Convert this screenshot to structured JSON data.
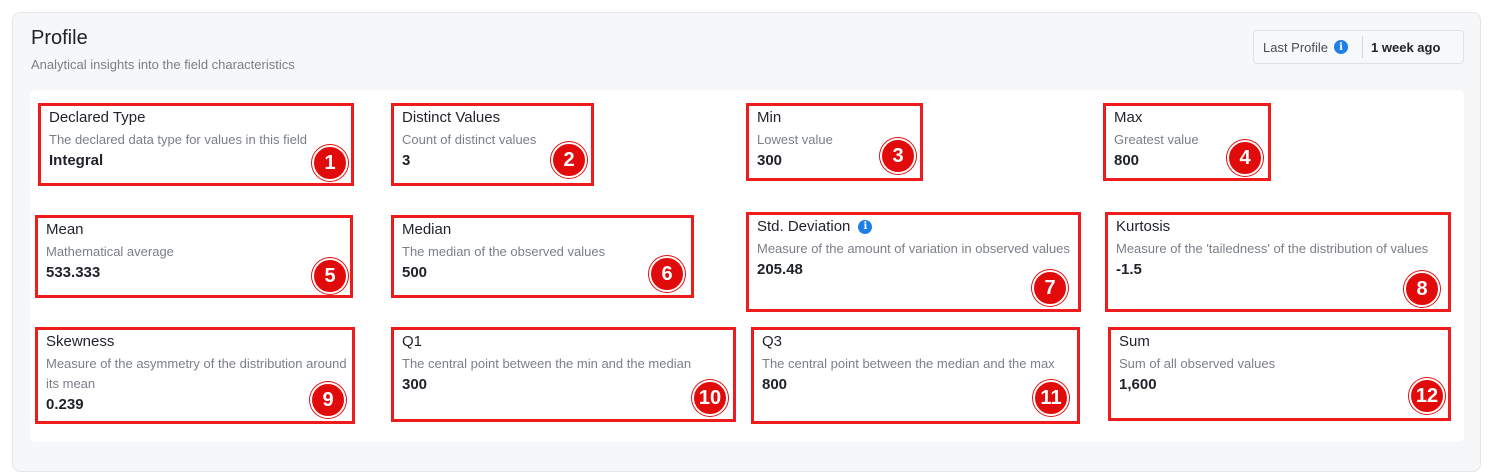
{
  "header": {
    "title": "Profile",
    "subtitle": "Analytical insights into the field characteristics",
    "last_profile_label": "Last Profile",
    "last_profile_info_icon": "info-icon",
    "last_profile_value": "1 week ago"
  },
  "metrics": [
    {
      "title": "Declared Type",
      "desc": "The declared data type for values in this field",
      "value": "Integral",
      "badge": "1"
    },
    {
      "title": "Distinct Values",
      "desc": "Count of distinct values",
      "value": "3",
      "badge": "2"
    },
    {
      "title": "Min",
      "desc": "Lowest value",
      "value": "300",
      "badge": "3"
    },
    {
      "title": "Max",
      "desc": "Greatest value",
      "value": "800",
      "badge": "4"
    },
    {
      "title": "Mean",
      "desc": "Mathematical average",
      "value": "533.333",
      "badge": "5"
    },
    {
      "title": "Median",
      "desc": "The median of the observed values",
      "value": "500",
      "badge": "6"
    },
    {
      "title": "Std. Deviation",
      "desc": "Measure of the amount of variation in observed values",
      "value": "205.48",
      "badge": "7",
      "info_icon": "info-icon"
    },
    {
      "title": "Kurtosis",
      "desc": "Measure of the 'tailedness' of the distribution of values",
      "value": "-1.5",
      "badge": "8"
    },
    {
      "title": "Skewness",
      "desc": "Measure of the asymmetry of the distribution around its mean",
      "value": "0.239",
      "badge": "9"
    },
    {
      "title": "Q1",
      "desc": "The central point between the min and the median",
      "value": "300",
      "badge": "10"
    },
    {
      "title": "Q3",
      "desc": "The central point between the median and the max",
      "value": "800",
      "badge": "11"
    },
    {
      "title": "Sum",
      "desc": "Sum of all observed values",
      "value": "1,600",
      "badge": "12"
    }
  ],
  "colors": {
    "highlight_border": "#ee1c1c",
    "badge_fill": "#e10b0b",
    "info_icon": "#1e7fe6",
    "panel_bg": "#f6f7f8"
  }
}
